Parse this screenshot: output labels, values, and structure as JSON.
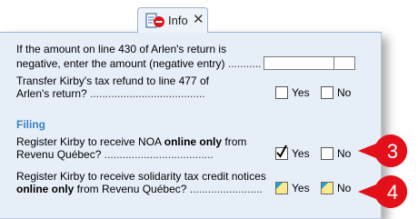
{
  "tab": {
    "label": "Info",
    "close_glyph": "✕",
    "icon": "document-stop-icon"
  },
  "questions": {
    "q1": {
      "line1": "If the amount on line 430 of Arlen's return is",
      "line2": "negative, enter the amount (negative entry)",
      "dots": "..........."
    },
    "q2": {
      "line1": "Transfer Kirby's tax refund to line 477 of",
      "line2": "Arlen's return?",
      "dots": "......................................",
      "yes": "Yes",
      "no": "No",
      "yes_checked": false,
      "no_checked": false
    }
  },
  "filing": {
    "title": "Filing",
    "q3": {
      "line1_pre": "Register Kirby to receive NOA ",
      "line1_bold": "online only",
      "line1_post": " from",
      "line2": "Revenu Québec?",
      "dots": "....................................",
      "yes": "Yes",
      "no": "No",
      "yes_checked": true,
      "no_checked": false
    },
    "q4": {
      "line1": "Register Kirby to receive solidarity tax credit notices",
      "line2_bold": "online only",
      "line2_post": " from Revenu Québec?",
      "dots": "........................",
      "yes": "Yes",
      "no": "No",
      "yes_checked": false,
      "no_checked": false
    }
  },
  "callouts": [
    "3",
    "4"
  ],
  "colors": {
    "panel_bg": "#e6eef8",
    "section_title": "#3b83c4",
    "callout_red": "#e3101a",
    "highlight_yellow": "#fde98a"
  }
}
